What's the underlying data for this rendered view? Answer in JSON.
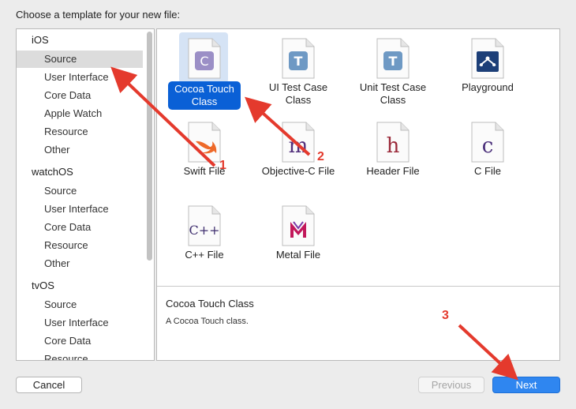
{
  "dialog": {
    "title": "Choose a template for your new file:"
  },
  "sidebar": {
    "groups": [
      {
        "label": "iOS",
        "items": [
          "Source",
          "User Interface",
          "Core Data",
          "Apple Watch",
          "Resource",
          "Other"
        ]
      },
      {
        "label": "watchOS",
        "items": [
          "Source",
          "User Interface",
          "Core Data",
          "Resource",
          "Other"
        ]
      },
      {
        "label": "tvOS",
        "items": [
          "Source",
          "User Interface",
          "Core Data",
          "Resource"
        ]
      }
    ],
    "selected": "Source"
  },
  "templates": [
    {
      "line1": "Cocoa Touch",
      "line2": "Class",
      "icon": "cocoa-touch-class-icon",
      "glyph": "C"
    },
    {
      "line1": "UI Test Case",
      "line2": "Class",
      "icon": "ui-test-case-class-icon",
      "glyph": "T"
    },
    {
      "line1": "Unit Test Case",
      "line2": "Class",
      "icon": "unit-test-case-class-icon",
      "glyph": "T"
    },
    {
      "line1": "Playground",
      "line2": "",
      "icon": "playground-icon",
      "glyph": ""
    },
    {
      "line1": "Swift File",
      "line2": "",
      "icon": "swift-file-icon",
      "glyph": ""
    },
    {
      "line1": "Objective-C File",
      "line2": "",
      "icon": "objective-c-file-icon",
      "glyph": "m"
    },
    {
      "line1": "Header File",
      "line2": "",
      "icon": "header-file-icon",
      "glyph": "h"
    },
    {
      "line1": "C File",
      "line2": "",
      "icon": "c-file-icon",
      "glyph": "c"
    },
    {
      "line1": "C++ File",
      "line2": "",
      "icon": "cpp-file-icon",
      "glyph": "C++"
    },
    {
      "line1": "Metal File",
      "line2": "",
      "icon": "metal-file-icon",
      "glyph": "M"
    }
  ],
  "description": {
    "title": "Cocoa Touch Class",
    "text": "A Cocoa Touch class."
  },
  "buttons": {
    "cancel": "Cancel",
    "previous": "Previous",
    "next": "Next"
  },
  "annotations": [
    "1",
    "2",
    "3"
  ],
  "colors": {
    "selection": "#0a60d6",
    "arrow": "#e43a2d",
    "next_button": "#2f86f0"
  }
}
